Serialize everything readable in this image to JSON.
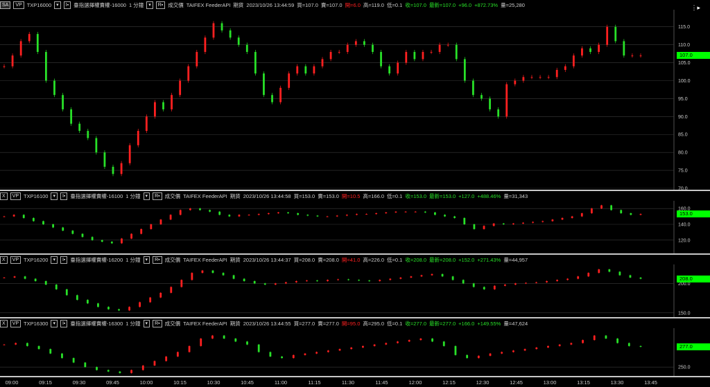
{
  "menu_icon": "menu-icon",
  "panes": [
    {
      "id": "p1",
      "buttons": [
        "SA",
        "VP"
      ],
      "symbol": "TXP16000",
      "drop1": "▾",
      "chk": "I▪",
      "title": "臺指選擇權賣權-16000",
      "interval": "1 分鐘",
      "drop2": "▾",
      "rbtn": "R▪",
      "type": "成交價",
      "feed": "TAIFEX  FeederAPI",
      "kind": "期貨",
      "datetime": "2023/10/26  13:44:59",
      "buy": "買=107.0",
      "sell": "賣=107.0",
      "open": "開=6.0",
      "high": "高=119.0",
      "low": "低=0.1",
      "close": "收=107.0",
      "last": "最新=107.0",
      "chg": "+96.0",
      "pct": "+872.73%",
      "vol": "量=25,280",
      "price_tag": "107.0",
      "yticks": [
        "115.0",
        "110.0",
        "105.0",
        "100.0",
        "95.0",
        "90.0",
        "85.0",
        "80.0",
        "75.0",
        "70.0"
      ]
    },
    {
      "id": "p2",
      "buttons": [
        "X",
        "VP"
      ],
      "symbol": "TXP16100",
      "drop1": "▾",
      "chk": "I▪",
      "title": "臺指選擇權賣權-16100",
      "interval": "1 分鐘",
      "drop2": "▾",
      "rbtn": "R▪",
      "type": "成交價",
      "feed": "TAIFEX  FeederAPI",
      "kind": "期貨",
      "datetime": "2023/10/26  13:44:58",
      "buy": "買=153.0",
      "sell": "賣=153.0",
      "open": "開=10.5",
      "high": "高=166.0",
      "low": "低=0.1",
      "close": "收=153.0",
      "last": "最新=153.0",
      "chg": "+127.0",
      "pct": "+488.46%",
      "vol": "量=31,343",
      "price_tag": "153.0",
      "yticks": [
        "160.0",
        "140.0",
        "120.0"
      ]
    },
    {
      "id": "p3",
      "buttons": [
        "X",
        "VP"
      ],
      "symbol": "TXP16200",
      "drop1": "▾",
      "chk": "I▪",
      "title": "臺指選擇權賣權-16200",
      "interval": "1 分鐘",
      "drop2": "▾",
      "rbtn": "R▪",
      "type": "成交價",
      "feed": "TAIFEX  FeederAPI",
      "kind": "期貨",
      "datetime": "2023/10/26  13:44:37",
      "buy": "買=208.0",
      "sell": "賣=208.0",
      "open": "開=41.0",
      "high": "高=226.0",
      "low": "低=0.1",
      "close": "收=208.0",
      "last": "最新=208.0",
      "chg": "+152.0",
      "pct": "+271.43%",
      "vol": "量=44,957",
      "price_tag": "208.0",
      "yticks": [
        "200.0",
        "150.0"
      ]
    },
    {
      "id": "p4",
      "buttons": [
        "X",
        "VP"
      ],
      "symbol": "TXP16300",
      "drop1": "▾",
      "chk": "I▪",
      "title": "臺指選擇權賣權-16300",
      "interval": "1 分鐘",
      "drop2": "▾",
      "rbtn": "R▪",
      "type": "成交價",
      "feed": "TAIFEX  FeederAPI",
      "kind": "期貨",
      "datetime": "2023/10/26  13:44:55",
      "buy": "買=277.0",
      "sell": "賣=277.0",
      "open": "開=95.0",
      "high": "高=295.0",
      "low": "低=0.1",
      "close": "收=277.0",
      "last": "最新=277.0",
      "chg": "+166.0",
      "pct": "+149.55%",
      "vol": "量=47,624",
      "price_tag": "277.0",
      "yticks": [
        "250.0"
      ]
    }
  ],
  "xaxis": [
    "09:00",
    "09:15",
    "09:30",
    "09:45",
    "10:00",
    "10:15",
    "10:30",
    "10:45",
    "11:00",
    "11:15",
    "11:30",
    "11:45",
    "12:00",
    "12:15",
    "12:30",
    "12:45",
    "13:00",
    "13:15",
    "13:30",
    "13:45"
  ],
  "colors": {
    "up": "#ff2020",
    "down": "#28e028",
    "tag": "#00ff00",
    "grid": "#3a3a3a"
  },
  "chart_data": [
    {
      "type": "candlestick",
      "symbol": "TXP16000",
      "ylim": [
        70,
        119
      ],
      "series_shape": [
        104,
        107,
        111,
        113,
        108,
        100,
        96,
        92,
        88,
        86,
        84,
        80,
        76,
        74,
        77,
        82,
        86,
        90,
        94,
        92,
        96,
        100,
        104,
        108,
        112,
        116,
        114,
        112,
        110,
        108,
        102,
        96,
        94,
        98,
        102,
        104,
        102,
        104,
        106,
        108,
        108,
        110,
        111,
        110,
        108,
        104,
        102,
        105,
        108,
        106,
        108,
        108,
        110,
        110,
        106,
        100,
        96,
        95,
        92,
        90,
        99,
        100,
        101,
        101,
        101,
        101,
        103,
        104,
        107,
        109,
        108,
        110,
        115,
        111,
        107,
        107,
        107
      ]
    },
    {
      "type": "candlestick",
      "symbol": "TXP16100",
      "ylim": [
        105,
        168
      ],
      "series_shape": [
        150,
        152,
        148,
        144,
        140,
        136,
        132,
        128,
        124,
        120,
        118,
        116,
        122,
        128,
        134,
        140,
        146,
        152,
        158,
        160,
        158,
        156,
        152,
        150,
        152,
        152,
        153,
        154,
        155,
        154,
        152,
        151,
        150,
        150,
        151,
        152,
        153,
        153,
        154,
        155,
        156,
        156,
        156,
        155,
        152,
        150,
        148,
        140,
        134,
        138,
        141,
        140,
        141,
        142,
        143,
        144,
        146,
        148,
        150,
        154,
        160,
        164,
        158,
        154,
        152,
        153
      ]
    },
    {
      "type": "candlestick",
      "symbol": "TXP16200",
      "ylim": [
        145,
        230
      ],
      "series_shape": [
        210,
        212,
        208,
        204,
        198,
        190,
        180,
        172,
        166,
        160,
        156,
        154,
        160,
        168,
        176,
        184,
        194,
        206,
        218,
        222,
        218,
        214,
        208,
        204,
        200,
        198,
        200,
        202,
        204,
        205,
        204,
        206,
        207,
        206,
        205,
        204,
        206,
        208,
        210,
        212,
        214,
        216,
        212,
        206,
        200,
        194,
        190,
        196,
        198,
        200,
        201,
        202,
        204,
        206,
        208,
        212,
        218,
        224,
        220,
        214,
        210,
        208
      ]
    },
    {
      "type": "candlestick",
      "symbol": "TXP16300",
      "ylim": [
        240,
        300
      ],
      "series_shape": [
        280,
        282,
        278,
        274,
        268,
        262,
        256,
        250,
        246,
        244,
        242,
        246,
        252,
        258,
        264,
        270,
        278,
        288,
        292,
        288,
        284,
        280,
        270,
        264,
        262,
        266,
        268,
        270,
        272,
        274,
        276,
        278,
        280,
        282,
        284,
        286,
        288,
        284,
        278,
        266,
        262,
        265,
        268,
        270,
        272,
        274,
        276,
        278,
        280,
        282,
        286,
        292,
        288,
        282,
        278,
        277
      ]
    }
  ]
}
